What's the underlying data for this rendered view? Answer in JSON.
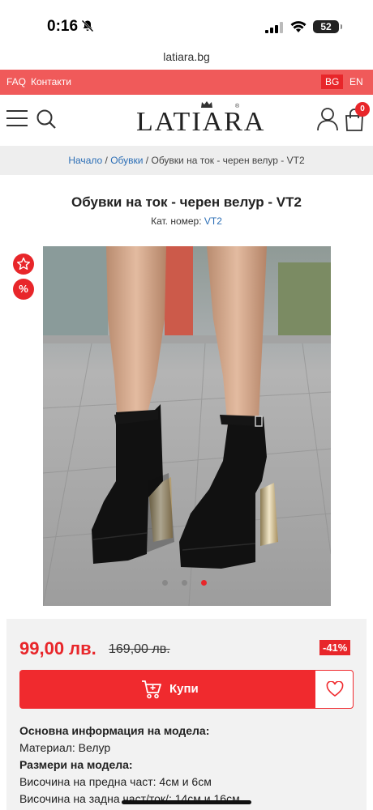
{
  "status_bar": {
    "time": "0:16",
    "battery": "52"
  },
  "browser": {
    "url": "latiara.bg"
  },
  "topbar": {
    "faq": "FAQ",
    "contacts": "Контакти",
    "lang_bg": "BG",
    "lang_en": "EN"
  },
  "header": {
    "logo": "LATIARA",
    "logo_reg": "®",
    "cart_count": "0"
  },
  "breadcrumb": {
    "home": "Начало",
    "sep1": " / ",
    "category": "Обувки",
    "sep2": " / ",
    "current": "Обувки на ток - черен велур - VT2"
  },
  "product": {
    "title": "Обувки на ток - черен велур - VT2",
    "sku_label": "Кат. номер: ",
    "sku_value": "VT2",
    "sale_badge": "%",
    "gallery_active_dot": 3
  },
  "pricing": {
    "current": "99,00 лв.",
    "old": "169,00 лв.",
    "discount": "-41%",
    "buy_label": "Купи"
  },
  "info": {
    "heading": "Основна информация на модела:",
    "material": "Материал: Велур",
    "sizes_heading": "Размери на модела:",
    "front_height": "Височина на предна част: 4см и 6см",
    "back_height": "Височина на задна част/ток/: 14см и 16см"
  },
  "colors": {
    "accent": "#e8262a",
    "topbar": "#f05a5a",
    "link": "#2d6fb6"
  }
}
